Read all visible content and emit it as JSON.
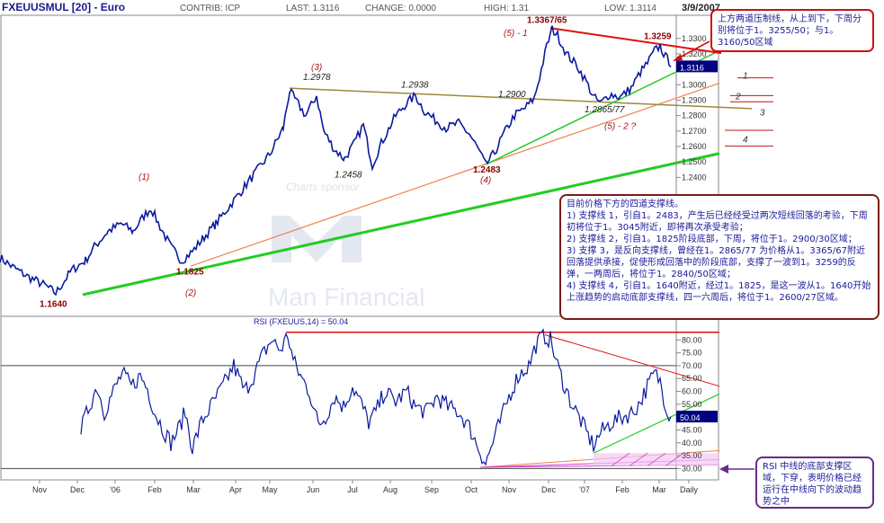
{
  "header": {
    "symbol": "FXEUUSMUL [20] - Euro",
    "contrib": "CONTRIB: ICP",
    "last": "LAST: 1.3116",
    "change": "CHANGE: 0.0000",
    "high": "HIGH: 1.31",
    "low": "LOW: 1.3114",
    "date": "3/9/2007"
  },
  "watermark": {
    "top": "Charts sponsor",
    "brand": "Man Financial"
  },
  "colors": {
    "price": "#0a1a9e",
    "support": "#22cc22",
    "resistance": "#e01010",
    "orange_trend": "#f08050",
    "olive_trend": "#9a8a3a",
    "annotation": "#8b0000",
    "wave": "#aa1111"
  },
  "chart_data": [
    {
      "type": "line",
      "name": "price",
      "title": "FXEUUSMUL [20] - Euro",
      "ylim": [
        1.15,
        1.345
      ],
      "ytick_labels": [
        "1.2400",
        "1.2500",
        "1.2600",
        "1.2700",
        "1.2800",
        "1.2900",
        "1.3000",
        "1.3100",
        "1.3200",
        "1.3300"
      ],
      "ytick_values": [
        1.24,
        1.25,
        1.26,
        1.27,
        1.28,
        1.29,
        1.3,
        1.31,
        1.32,
        1.33
      ],
      "x_labels": [
        "Nov",
        "Dec",
        "'06",
        "Feb",
        "Mar",
        "Apr",
        "May",
        "Jun",
        "Jul",
        "Aug",
        "Sep",
        "Oct",
        "Nov",
        "Dec",
        "'07",
        "Feb",
        "Mar",
        "Daily"
      ],
      "last_value": "1.3116",
      "waypoints": [
        [
          0,
          1.188
        ],
        [
          14,
          1.182
        ],
        [
          30,
          1.176
        ],
        [
          50,
          1.17
        ],
        [
          62,
          1.165
        ],
        [
          68,
          1.17
        ],
        [
          80,
          1.18
        ],
        [
          95,
          1.186
        ],
        [
          105,
          1.195
        ],
        [
          120,
          1.205
        ],
        [
          135,
          1.21
        ],
        [
          148,
          1.205
        ],
        [
          160,
          1.215
        ],
        [
          168,
          1.22
        ],
        [
          178,
          1.208
        ],
        [
          190,
          1.195
        ],
        [
          202,
          1.186
        ],
        [
          214,
          1.192
        ],
        [
          225,
          1.2
        ],
        [
          240,
          1.21
        ],
        [
          260,
          1.225
        ],
        [
          280,
          1.24
        ],
        [
          300,
          1.255
        ],
        [
          315,
          1.272
        ],
        [
          322,
          1.296
        ],
        [
          332,
          1.287
        ],
        [
          340,
          1.28
        ],
        [
          352,
          1.293
        ],
        [
          360,
          1.27
        ],
        [
          372,
          1.258
        ],
        [
          383,
          1.252
        ],
        [
          394,
          1.262
        ],
        [
          404,
          1.274
        ],
        [
          414,
          1.248
        ],
        [
          424,
          1.262
        ],
        [
          440,
          1.28
        ],
        [
          452,
          1.288
        ],
        [
          462,
          1.293
        ],
        [
          472,
          1.283
        ],
        [
          482,
          1.278
        ],
        [
          496,
          1.272
        ],
        [
          510,
          1.275
        ],
        [
          522,
          1.268
        ],
        [
          532,
          1.258
        ],
        [
          540,
          1.248
        ],
        [
          550,
          1.256
        ],
        [
          560,
          1.268
        ],
        [
          572,
          1.28
        ],
        [
          584,
          1.285
        ],
        [
          594,
          1.291
        ],
        [
          600,
          1.305
        ],
        [
          608,
          1.325
        ],
        [
          614,
          1.336
        ],
        [
          620,
          1.332
        ],
        [
          630,
          1.32
        ],
        [
          642,
          1.312
        ],
        [
          652,
          1.302
        ],
        [
          660,
          1.292
        ],
        [
          668,
          1.288
        ],
        [
          678,
          1.294
        ],
        [
          690,
          1.292
        ],
        [
          702,
          1.298
        ],
        [
          712,
          1.308
        ],
        [
          720,
          1.314
        ],
        [
          728,
          1.322
        ],
        [
          734,
          1.325
        ],
        [
          740,
          1.318
        ],
        [
          746,
          1.314
        ]
      ],
      "labels": [
        {
          "text": "1.1640",
          "kind": "low"
        },
        {
          "text": "1.1825",
          "kind": "low"
        },
        {
          "text": "1.2978",
          "kind": "high"
        },
        {
          "text": "1.2458",
          "kind": "low"
        },
        {
          "text": "1.2938",
          "kind": "high"
        },
        {
          "text": "1.2900",
          "kind": "high"
        },
        {
          "text": "1.2483",
          "kind": "low"
        },
        {
          "text": "1.3367/65",
          "kind": "high"
        },
        {
          "text": "1.2865/77",
          "kind": "low"
        },
        {
          "text": "1.3259",
          "kind": "high"
        }
      ],
      "waves": [
        "(1)",
        "(2)",
        "(3)",
        "(4)",
        "(5) - 1",
        "(5) - 2  ?"
      ],
      "level_markers": [
        "1",
        "2",
        "3",
        "4"
      ]
    },
    {
      "type": "line",
      "name": "RSI",
      "title": "RSI (FXEUUS,14) = 50.04",
      "ylim": [
        27,
        85
      ],
      "ytick_labels": [
        "30.00",
        "35.00",
        "40.00",
        "45.00",
        "50.00",
        "55.00",
        "60.00",
        "65.00",
        "70.00",
        "75.00",
        "80.00"
      ],
      "ytick_values": [
        30,
        35,
        40,
        45,
        50,
        55,
        60,
        65,
        70,
        75,
        80
      ],
      "reference_lines": [
        70,
        30
      ],
      "last_value": "50.04",
      "waypoints": [
        [
          90,
          45
        ],
        [
          100,
          55
        ],
        [
          108,
          62
        ],
        [
          116,
          52
        ],
        [
          126,
          60
        ],
        [
          136,
          67
        ],
        [
          146,
          62
        ],
        [
          156,
          66
        ],
        [
          164,
          61
        ],
        [
          172,
          52
        ],
        [
          182,
          45
        ],
        [
          190,
          40
        ],
        [
          198,
          45
        ],
        [
          206,
          52
        ],
        [
          214,
          38
        ],
        [
          224,
          48
        ],
        [
          236,
          55
        ],
        [
          248,
          62
        ],
        [
          260,
          70
        ],
        [
          272,
          60
        ],
        [
          282,
          66
        ],
        [
          292,
          74
        ],
        [
          302,
          80
        ],
        [
          312,
          76
        ],
        [
          320,
          82
        ],
        [
          326,
          72
        ],
        [
          334,
          66
        ],
        [
          344,
          60
        ],
        [
          354,
          47
        ],
        [
          362,
          50
        ],
        [
          372,
          58
        ],
        [
          382,
          54
        ],
        [
          392,
          62
        ],
        [
          402,
          55
        ],
        [
          410,
          48
        ],
        [
          418,
          52
        ],
        [
          428,
          60
        ],
        [
          440,
          56
        ],
        [
          452,
          60
        ],
        [
          462,
          54
        ],
        [
          474,
          52
        ],
        [
          486,
          58
        ],
        [
          498,
          54
        ],
        [
          510,
          52
        ],
        [
          522,
          46
        ],
        [
          532,
          38
        ],
        [
          540,
          32
        ],
        [
          548,
          40
        ],
        [
          558,
          50
        ],
        [
          566,
          58
        ],
        [
          576,
          66
        ],
        [
          588,
          70
        ],
        [
          596,
          78
        ],
        [
          604,
          82
        ],
        [
          612,
          80
        ],
        [
          620,
          70
        ],
        [
          628,
          62
        ],
        [
          636,
          55
        ],
        [
          644,
          50
        ],
        [
          652,
          44
        ],
        [
          660,
          39
        ],
        [
          668,
          44
        ],
        [
          680,
          48
        ],
        [
          692,
          50
        ],
        [
          704,
          52
        ],
        [
          712,
          56
        ],
        [
          720,
          62
        ],
        [
          728,
          67
        ],
        [
          734,
          64
        ],
        [
          740,
          55
        ],
        [
          746,
          50
        ]
      ]
    }
  ],
  "notes": {
    "top": "上方两道压制线，从上到下，下周分别将位于1。3255/50；与1。3160/50区域",
    "mid": [
      "目前价格下方的四道支撑线。",
      "1) 支撑线 1，引自1。2483，产生后已经经受过两次短线回落的考验，下周初将位于1。3045附近，即将再次承受考验；",
      "2) 支撑线 2，引自1。1825阶段底部，下周，将位于1。2900/30区域；",
      "3) 支撑 3，是反向支撑线，曾经在1。2865/77 为价格从1。3365/67附近回落提供承接，促使形成回落中的阶段底部，支撑了一波到1。3259的反弹，一两周后，将位于1。2840/50区域；",
      "4) 支撑线 4，引自1。1640附近，经过1。1825，是这一波从1。1640开始上涨趋势的启动底部支撑线，四一六周后，将位于1。2600/27区域。"
    ],
    "bottom": "RSI 中线的底部支撑区域，下穿，表明价格已经运行在中线向下的波动趋势之中"
  }
}
